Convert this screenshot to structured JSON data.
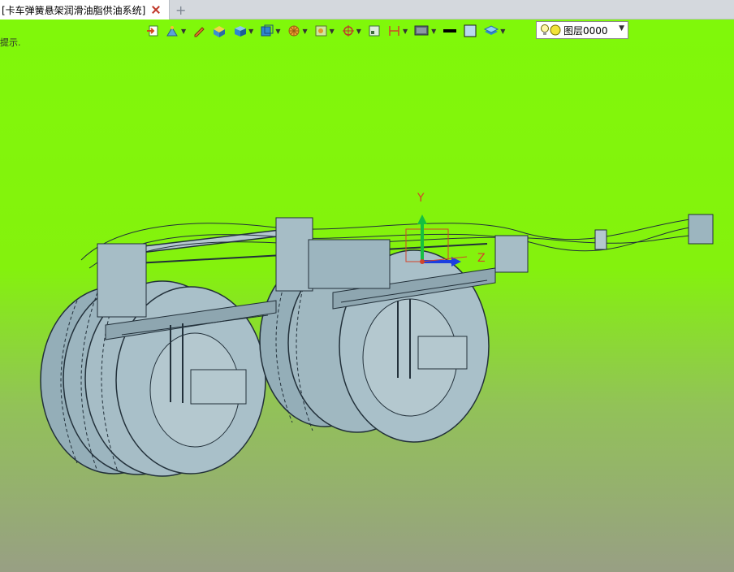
{
  "tab": {
    "title": "[卡车弹簧悬架润滑油脂供油系统]",
    "add_label": "+"
  },
  "viewport": {
    "hint": "提示."
  },
  "toolbar": {
    "tools": [
      "import-icon",
      "sketch-icon",
      "pencil-icon",
      "box-icon",
      "cube-icon",
      "view-cube-icon",
      "render-icon",
      "frame-icon",
      "snap-icon",
      "window-icon",
      "dimension-icon",
      "display-icon",
      "line-weight-icon",
      "color-icon",
      "layers-icon"
    ]
  },
  "layer_selector": {
    "value": "图层0000"
  },
  "triad": {
    "y_label": "Y",
    "z_label": "Z"
  },
  "colors": {
    "background_top": "#80f80a",
    "background_bottom": "#989f84",
    "model_fill": "#a6bdc6",
    "model_line": "#22303a",
    "axis_y": "#16c040",
    "axis_z": "#1b3ee0",
    "axis_label": "#d2442a"
  }
}
